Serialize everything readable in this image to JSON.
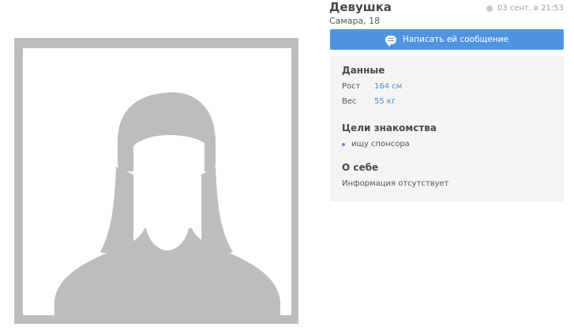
{
  "profile": {
    "name": "Девушка",
    "location": "Самара, 18",
    "last_seen": "03 сент. в 21:53",
    "message_button": "Написать ей сообщение",
    "message_icon": "chat-bubble-icon",
    "avatar_icon": "female-avatar-placeholder"
  },
  "details": {
    "section_title": "Данные",
    "height_label": "Рост",
    "height_value": "164 см",
    "weight_label": "Вес",
    "weight_value": "55 кг"
  },
  "goals": {
    "section_title": "Цели знакомства",
    "items": [
      "ищу спонсора"
    ]
  },
  "about": {
    "section_title": "О себе",
    "text": "Информация отсутствует"
  },
  "colors": {
    "accent": "#4f94e0",
    "panel_bg": "#f4f4f4",
    "placeholder_gray": "#bdbdbd",
    "status_dot": "#c8c8c8"
  }
}
